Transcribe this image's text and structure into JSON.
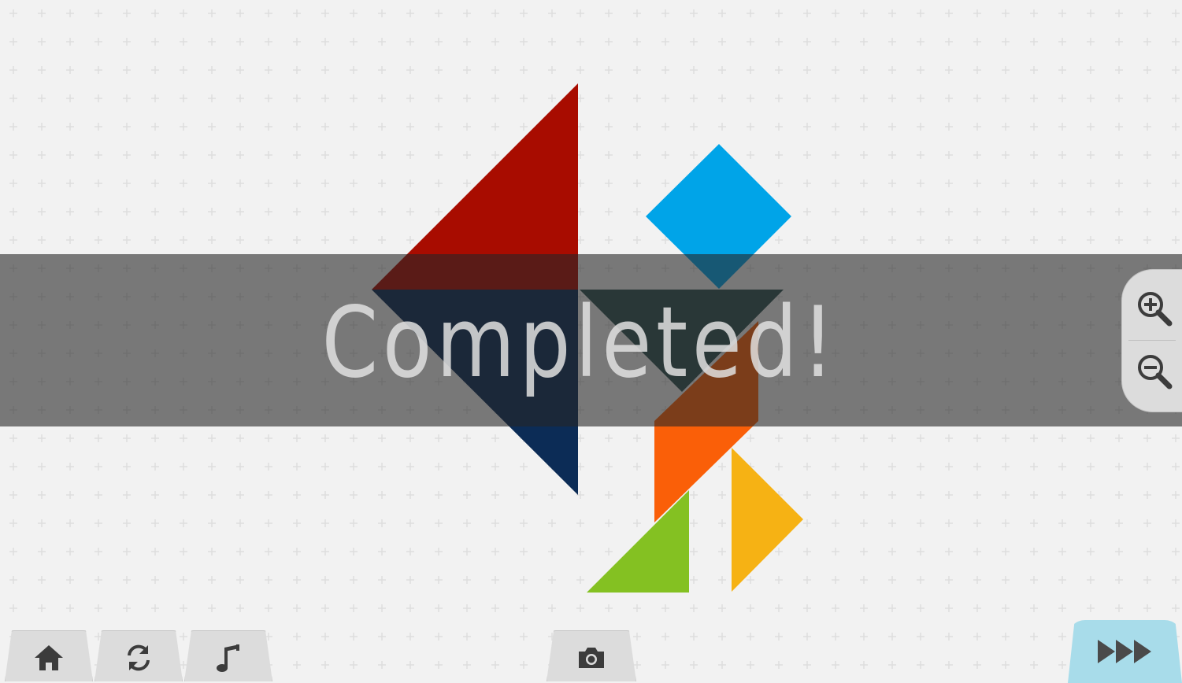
{
  "banner": {
    "text": "Completed!"
  },
  "colors": {
    "background": "#f2f2f2",
    "grid_mark": "#dedede",
    "banner_overlay": "rgba(38,38,38,0.6)",
    "button_face": "#dcdcdc",
    "icon": "#3c3c3c",
    "next_button": "#a8dcea",
    "next_icon": "#4a4a4a"
  },
  "pieces": [
    {
      "name": "red-large-triangle",
      "color": "#a80c00"
    },
    {
      "name": "navy-large-triangle",
      "color": "#0c2c56"
    },
    {
      "name": "blue-square",
      "color": "#00a4e8"
    },
    {
      "name": "teal-medium-triangle",
      "color": "#2f5050"
    },
    {
      "name": "orange-parallelogram",
      "color": "#fa5f08"
    },
    {
      "name": "green-small-triangle",
      "color": "#84c122"
    },
    {
      "name": "yellow-small-triangle",
      "color": "#f6b214"
    }
  ],
  "toolbar": {
    "home": {
      "icon": "home-icon"
    },
    "restart": {
      "icon": "restart-icon"
    },
    "music": {
      "icon": "music-note-icon"
    },
    "camera": {
      "icon": "camera-icon"
    },
    "next": {
      "icon": "fast-forward-icon"
    }
  },
  "zoom": {
    "in_icon": "zoom-in-icon",
    "out_icon": "zoom-out-icon"
  }
}
